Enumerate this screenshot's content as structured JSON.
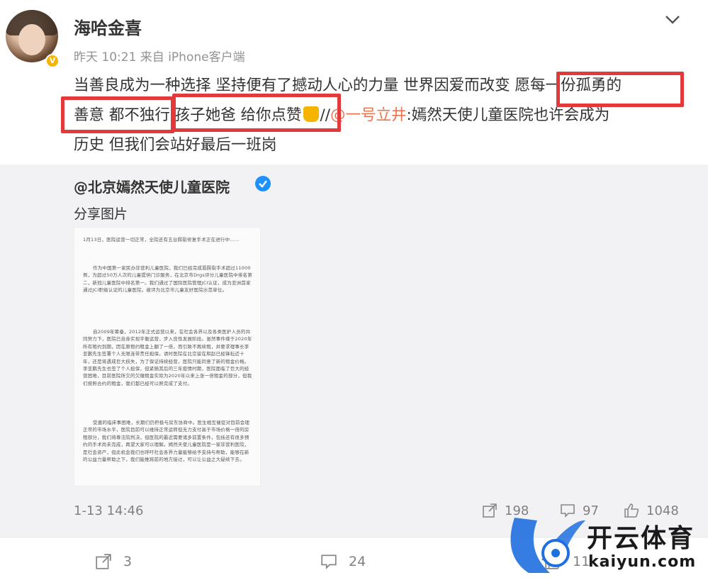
{
  "post": {
    "username": "海哈金喜",
    "meta": "昨天 10:21  来自 iPhone客户端",
    "lines": [
      "当善良成为一种选择 坚持便有了撼动人心的力量 世界因爱而改变 愿每一份孤勇的",
      "善意 都不独行 孩子她爸 给你点赞",
      "历史 但我们会站好最后一班岗"
    ],
    "repost_mark": "//",
    "mention": "@一号立井",
    "line2_tail": ":嫣然天使儿童医院也许会成为"
  },
  "repost": {
    "source": "@北京嫣然天使儿童医院",
    "text": "分享图片",
    "document": [
      "1月13日，医院运营一切正常，全院还有五台腭裂修复手术正在进行中……",
      "作为中国第一家民办非营利儿童医院，我们已经完成唇腭裂手术超过11000例，为超过50万人次的儿童提供门诊服务，在北京市Drgs评分儿童医院中排名第二，新冠儿童医院中排名第一。我们通过了国际医院管理JCI认证，成为亚洲首家通过JCI职级认证的儿童医院，被评为北京市儿童友好医院示范单位。",
      "自2009年筹备，2012年正式运营以来，在社会各界以及各类医护人员的共同努力下，医院已自身实现平衡运营，步入良性发展阶段。虽然事件缘于2020年所有租约到期，因在原租约租金上翻了一倍，而引致不再续租，并要求理事长李亚鹏先生签署个人无限连带责任担保。请时医院在北京留在和赵已经锋耘近十年，还是将遇成巨大损失，为了保证持续经营，医院只能同意了新的租金价格。李亚鹏先生也签了个人担保，但紧随其后的三年疫情时期，医院面临了巨大的经营困难，目前医院所欠的欠缴租金实际为2020年以来上涨一倍租金的部分，但我们按照合约的租金，我们都已经可以照完成了支付。",
      "受邀的临床事困难，长期们仍积极与房东协商中。医生相互催促对目前会理正常的市场水平，医院目前可以维持正常运转但无力支付高于市场价格一倍的房租部分，我们将尊法院判决，但医院的最近需要诸多前置条件，包括还有很多预约的手术尚未完成，再望大家可以理解。嫣然天使儿童医院是一家非营利医院，是社会资产，但此机会我们也呼吁社会各界力量能够给予支持与帮助，能够在新的公益力量帮助之下，我们能推跨前的地方接过，可以让公益之大疑续下去。"
    ],
    "timestamp": "1-13 14:46",
    "shares": "198",
    "comments": "97",
    "likes": "1048"
  },
  "bottom": {
    "shares": "3",
    "comments": "24",
    "likes": "11"
  },
  "watermark": {
    "title": "开云体育",
    "url": "kaiyun.com"
  },
  "colors": {
    "highlight": "#e23a3a",
    "mention": "#eb7350",
    "badge_gold": "#f7b500",
    "badge_blue": "#1e90ff",
    "watermark_blue": "#1f6fe0"
  }
}
